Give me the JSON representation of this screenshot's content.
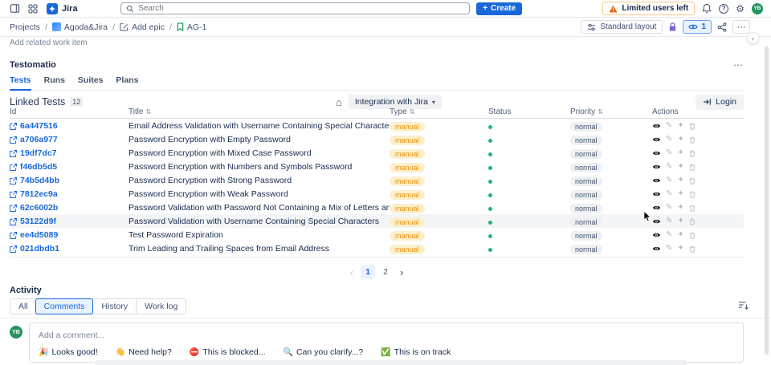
{
  "icons": {
    "more": "⋯",
    "home": "⌂",
    "sort_updown": "⇅",
    "gear": "⚙",
    "chevron_down": "▾",
    "chevron_left": "‹",
    "chevron_right": "›",
    "pencil": "✎",
    "sparkle": "✦",
    "question": "?",
    "plus": "+"
  },
  "topbar": {
    "app_name": "Jira",
    "search_placeholder": "Search",
    "create_label": "Create",
    "limited_users_label": "Limited users left",
    "avatar_initials": "YB"
  },
  "breadcrumb": {
    "separator": "/",
    "projects": "Projects",
    "project": "Agoda&Jira",
    "add_epic": "Add epic",
    "workitem": "AG-1"
  },
  "toolbar": {
    "standard_layout_label": "Standard layout",
    "watchers_count": "1"
  },
  "page": {
    "add_related_label": "Add related work item"
  },
  "panel": {
    "title": "Testomatio",
    "tabs": [
      {
        "label": "Tests"
      },
      {
        "label": "Runs"
      },
      {
        "label": "Suites"
      },
      {
        "label": "Plans"
      }
    ],
    "active_tab": "Tests",
    "linked_tests_label": "Linked Tests",
    "linked_tests_count": "12",
    "integration_label": "Integration with Jira",
    "login_label": "Login"
  },
  "table": {
    "columns": [
      {
        "label": "Id",
        "sortable": false
      },
      {
        "label": "Title",
        "sortable": true
      },
      {
        "label": "Type",
        "sortable": true
      },
      {
        "label": "Status",
        "sortable": false
      },
      {
        "label": "Priority",
        "sortable": true
      },
      {
        "label": "Actions",
        "sortable": false
      }
    ],
    "hovered_row": "53122d9f",
    "rows": [
      {
        "id": "6a447516",
        "title": "Email Address Validation with Username Containing Special Characters",
        "type": "manual",
        "status": "green",
        "priority": "normal"
      },
      {
        "id": "a706a977",
        "title": "Password Encryption with Empty Password",
        "type": "manual",
        "status": "green",
        "priority": "normal"
      },
      {
        "id": "19df7dc7",
        "title": "Password Encryption with Mixed Case Password",
        "type": "manual",
        "status": "green",
        "priority": "normal"
      },
      {
        "id": "f46db5d5",
        "title": "Password Encryption with Numbers and Symbols Password",
        "type": "manual",
        "status": "green",
        "priority": "normal"
      },
      {
        "id": "74b5d4bb",
        "title": "Password Encryption with Strong Password",
        "type": "manual",
        "status": "green",
        "priority": "normal"
      },
      {
        "id": "7812ec9a",
        "title": "Password Encryption with Weak Password",
        "type": "manual",
        "status": "green",
        "priority": "normal"
      },
      {
        "id": "62c6002b",
        "title": "Password Validation with Password Not Containing a Mix of Letters and Numbers",
        "type": "manual",
        "status": "green",
        "priority": "normal"
      },
      {
        "id": "53122d9f",
        "title": "Password Validation with Username Containing Special Characters",
        "type": "manual",
        "status": "green",
        "priority": "normal"
      },
      {
        "id": "ee4d5089",
        "title": "Test Password Expiration",
        "type": "manual",
        "status": "green",
        "priority": "normal"
      },
      {
        "id": "021dbdb1",
        "title": "Trim Leading and Trailing Spaces from Email Address",
        "type": "manual",
        "status": "green",
        "priority": "normal"
      }
    ]
  },
  "pagination": {
    "pages": [
      {
        "label": "1"
      },
      {
        "label": "2"
      }
    ],
    "current": "1"
  },
  "activity": {
    "title": "Activity",
    "tabs": [
      {
        "label": "All"
      },
      {
        "label": "Comments"
      },
      {
        "label": "History"
      },
      {
        "label": "Work log"
      }
    ],
    "active_tab": "Comments",
    "avatar_initials": "YB",
    "comment_placeholder": "Add a comment...",
    "quick_replies": [
      {
        "emoji": "🎉",
        "label": "Looks good!"
      },
      {
        "emoji": "👋",
        "label": "Need help?"
      },
      {
        "emoji": "⛔",
        "label": "This is blocked..."
      },
      {
        "emoji": "🔍",
        "label": "Can you clarify...?"
      },
      {
        "emoji": "✅",
        "label": "This is on track"
      }
    ]
  },
  "colors": {
    "accent_blue": "#1868db",
    "warning_orange": "#e56910",
    "type_badge_bg": "#fcefcc",
    "type_badge_text": "#e8930c",
    "status_green": "#24b47e",
    "priority_badge_bg": "#eef0f2",
    "lock_purple": "#7b68d9",
    "avatar_green": "#24945f"
  }
}
